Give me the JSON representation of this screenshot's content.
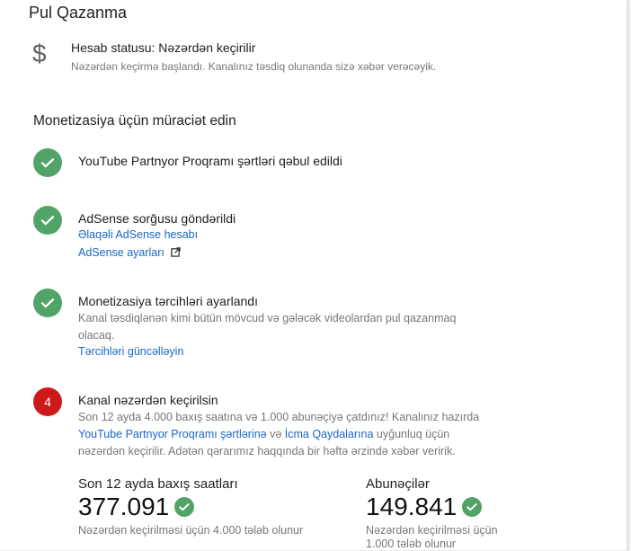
{
  "page": {
    "title": "Pul Qazanma"
  },
  "status": {
    "title": "Hesab statusu: Nəzərdən keçirilir",
    "subtitle": "Nəzərdən keçirmə başlandı. Kanalınız təsdiq olunanda sizə xəbər verəcəyik."
  },
  "section": {
    "title": "Monetizasiya üçün müraciət edin"
  },
  "steps": [
    {
      "title": "YouTube Partnyor Proqramı şərtləri qəbul edildi"
    },
    {
      "title": "AdSense sorğusu göndərildi",
      "link1": "Əlaqəli AdSense hesabı",
      "link2": "AdSense ayarları"
    },
    {
      "title": "Monetizasiya tərcihləri ayarlandı",
      "desc_line1": "Kanal təsdiqlənən kimi bütün mövcud və gələcək videolardan pul qazanmaq",
      "desc_line2": "olacaq.",
      "link": "Tərcihləri güncəlləyin"
    },
    {
      "number": "4",
      "title": "Kanal nəzərdən keçirilsin",
      "desc_a": "Son 12 ayda 4.000 baxış saatına və 1.000 abunəçiyə çatdınız! Kanalınız hazırda",
      "link_terms": "YouTube Partnyor Proqramı şərtlərinə",
      "desc_b": " və ",
      "link_guidelines": "İcma Qaydalarına",
      "desc_c": " uyğunluq üçün",
      "desc_d": "nəzərdən keçirilir. Adətən qərarımız haqqında bir həftə ərzində xəbər veririk."
    }
  ],
  "stats": {
    "watch_hours": {
      "label": "Son 12 ayda baxış saatları",
      "value": "377.091",
      "note": "Nəzərdən keçirilməsi üçün 4.000 tələb olunur"
    },
    "subscribers": {
      "label": "Abunəçilər",
      "value": "149.841",
      "note_line1": "Nəzərdən keçirilməsi üçün",
      "note_line2": "1.000 tələb olunur"
    }
  },
  "icons": {
    "dollar": "dollar-icon",
    "check": "check-icon",
    "external": "external-link-icon"
  },
  "colors": {
    "success": "#52a368",
    "alert": "#cc1a1a",
    "link": "#1a66c7"
  }
}
